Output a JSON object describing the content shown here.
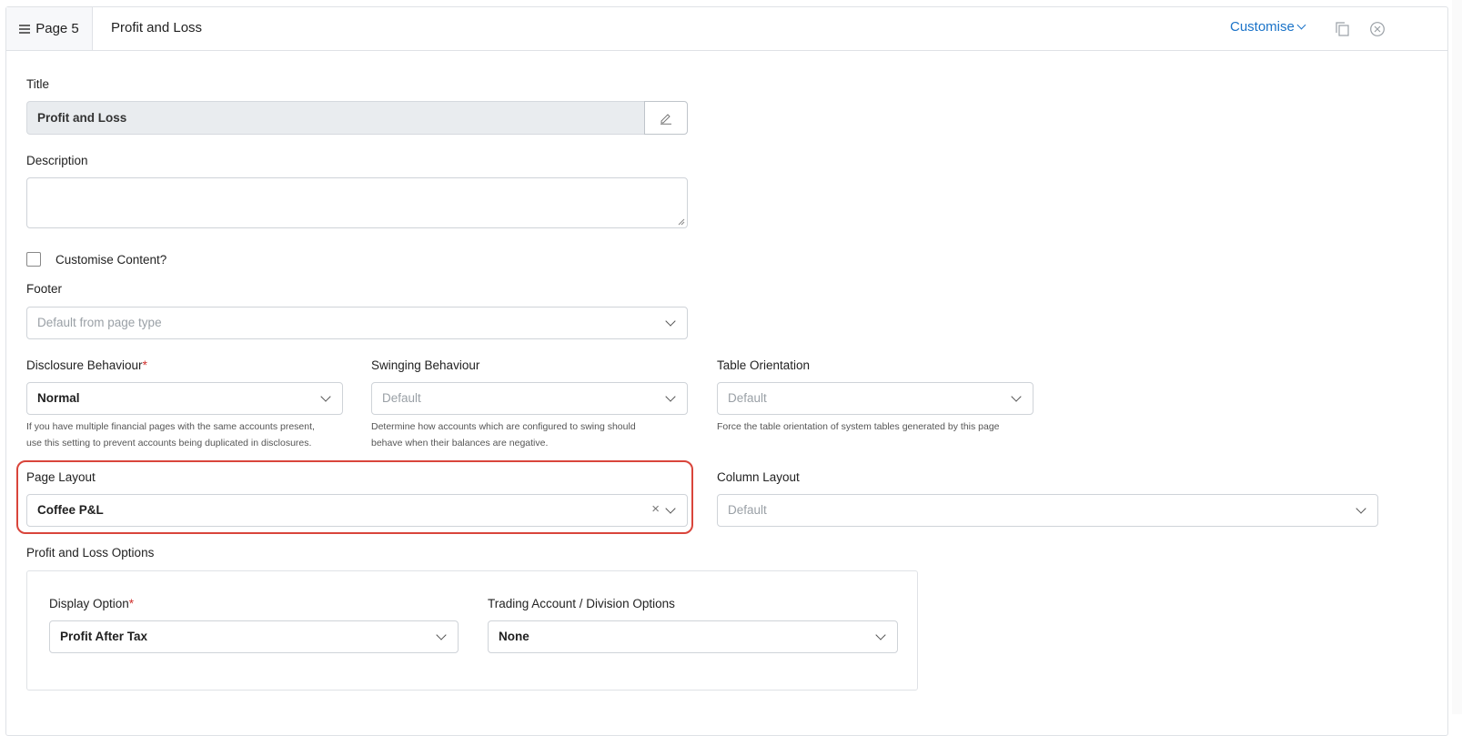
{
  "header": {
    "page_label": "Page 5",
    "title": "Profit and Loss",
    "customise_label": "Customise"
  },
  "form": {
    "title_label": "Title",
    "title_value": "Profit and Loss",
    "description_label": "Description",
    "description_value": "",
    "customise_content_label": "Customise Content?",
    "customise_content_checked": false,
    "footer_label": "Footer",
    "footer_placeholder": "Default from page type",
    "disclosure": {
      "label": "Disclosure Behaviour",
      "required": "*",
      "value": "Normal",
      "help_line1": "If you have multiple financial pages with the same accounts present,",
      "help_line2": "use this setting to prevent accounts being duplicated in disclosures."
    },
    "swinging": {
      "label": "Swinging Behaviour",
      "placeholder": "Default",
      "help_line1": "Determine how accounts which are configured to swing should",
      "help_line2": "behave when their balances are negative."
    },
    "table_orientation": {
      "label": "Table Orientation",
      "placeholder": "Default",
      "help": "Force the table orientation of system tables generated by this page"
    },
    "page_layout": {
      "label": "Page Layout",
      "value": "Coffee P&L",
      "clear": "×"
    },
    "column_layout": {
      "label": "Column Layout",
      "placeholder": "Default"
    },
    "pl_options": {
      "label": "Profit and Loss Options",
      "display_option": {
        "label": "Display Option",
        "required": "*",
        "value": "Profit After Tax"
      },
      "trading_account": {
        "label": "Trading Account / Division Options",
        "value": "None"
      }
    }
  },
  "colors": {
    "accent": "#1a73c8",
    "required": "#d0312d",
    "highlight": "#d9453b"
  }
}
